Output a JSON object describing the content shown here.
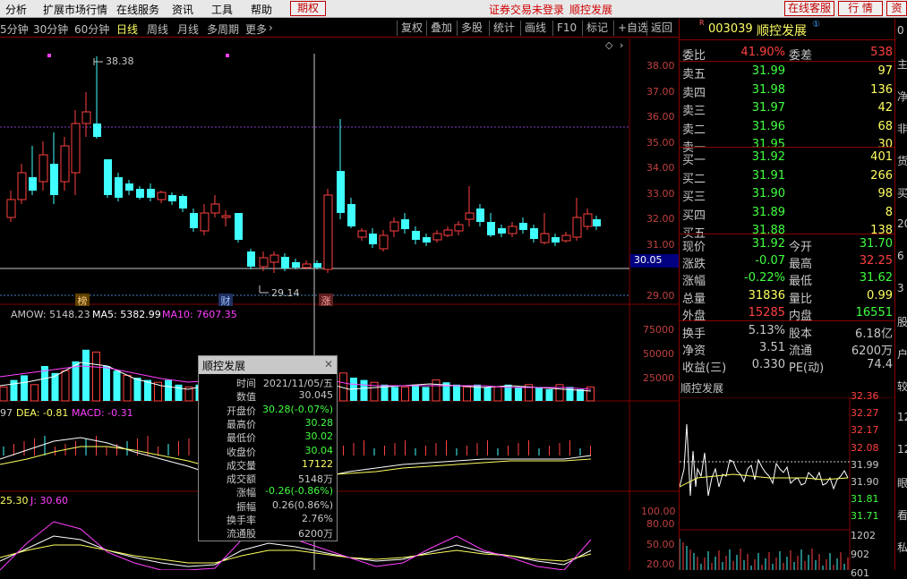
{
  "menu": {
    "items": [
      "分析",
      "扩展市场行情",
      "在线服务",
      "资讯",
      "工具",
      "帮助"
    ],
    "period_btn": "期权",
    "status_text": "证券交易未登录",
    "stock_name": "顺控发展",
    "right_buttons": [
      "在线客服",
      "行 情",
      "资"
    ]
  },
  "toolbar": {
    "periods": [
      "5分钟",
      "30分钟",
      "60分钟",
      "日线",
      "周线",
      "月线",
      "多周期",
      "更多"
    ],
    "active": "日线",
    "tools": [
      "复权",
      "叠加",
      "多股",
      "统计",
      "画线",
      "F10",
      "标记",
      "+自选",
      "返回"
    ]
  },
  "main_chart": {
    "price_axis": [
      "38.00",
      "37.00",
      "36.00",
      "35.00",
      "34.00",
      "33.00",
      "32.00",
      "31.00",
      "30.00",
      "29.00"
    ],
    "high_label": "38.38",
    "low_label": "29.14",
    "cursor_price": "30.05",
    "markers": [
      "榜",
      "财",
      "涨"
    ]
  },
  "volume_panel": {
    "labels": [
      {
        "text": "AMOW: 5148.23",
        "color": "#c8c8c8"
      },
      {
        "text": "MA5: 5382.99",
        "color": "#ffffff"
      },
      {
        "text": "MA10: 7607.35",
        "color": "#ff40ff"
      }
    ],
    "axis": [
      "75000",
      "50000",
      "25000"
    ]
  },
  "macd_panel": {
    "labels": [
      {
        "text": "97",
        "color": "#c8c8c8"
      },
      {
        "text": "DEA: -0.81",
        "color": "#ffff60"
      },
      {
        "text": "MACD: -0.31",
        "color": "#ff40ff"
      }
    ]
  },
  "kdj_panel": {
    "labels": [
      {
        "text": "25.30",
        "color": "#ffff60"
      },
      {
        "text": "J: 30.60",
        "color": "#ff40ff"
      }
    ],
    "axis": [
      "100.00",
      "80.00",
      "50.00",
      "20.00"
    ]
  },
  "popup": {
    "title": "顺控发展",
    "rows": [
      {
        "label": "时间",
        "value": "2021/11/05/五",
        "color": "#c8c8c8"
      },
      {
        "label": "数值",
        "value": "30.045",
        "color": "#c8c8c8"
      },
      {
        "label": "开盘价",
        "value": "30.28(-0.07%)",
        "color": "#40ff40"
      },
      {
        "label": "最高价",
        "value": "30.28",
        "color": "#40ff40"
      },
      {
        "label": "最低价",
        "value": "30.02",
        "color": "#40ff40"
      },
      {
        "label": "收盘价",
        "value": "30.04",
        "color": "#40ff40"
      },
      {
        "label": "成交量",
        "value": "17122",
        "color": "#ffff60"
      },
      {
        "label": "成交额",
        "value": "5148万",
        "color": "#c8c8c8"
      },
      {
        "label": "涨幅",
        "value": "-0.26(-0.86%)",
        "color": "#40ff40"
      },
      {
        "label": "振幅",
        "value": "0.26(0.86%)",
        "color": "#c8c8c8"
      },
      {
        "label": "换手率",
        "value": "2.76%",
        "color": "#c8c8c8"
      },
      {
        "label": "流通股",
        "value": "6200万",
        "color": "#c8c8c8"
      }
    ]
  },
  "quote": {
    "code": "003039",
    "name": "顺控发展",
    "weibi_label": "委比",
    "weibi": "41.90%",
    "weicha_label": "委差",
    "weicha": "538",
    "sells": [
      {
        "label": "卖五",
        "price": "31.99",
        "vol": "97"
      },
      {
        "label": "卖四",
        "price": "31.98",
        "vol": "136"
      },
      {
        "label": "卖三",
        "price": "31.97",
        "vol": "42"
      },
      {
        "label": "卖二",
        "price": "31.96",
        "vol": "68"
      },
      {
        "label": "卖一",
        "price": "31.95",
        "vol": "30"
      }
    ],
    "buys": [
      {
        "label": "买一",
        "price": "31.92",
        "vol": "401"
      },
      {
        "label": "买二",
        "price": "31.91",
        "vol": "266"
      },
      {
        "label": "买三",
        "price": "31.90",
        "vol": "98"
      },
      {
        "label": "买四",
        "price": "31.89",
        "vol": "8"
      },
      {
        "label": "买五",
        "price": "31.88",
        "vol": "138"
      }
    ],
    "stats": [
      {
        "l1": "现价",
        "v1": "31.92",
        "c1": "#40ff40",
        "l2": "今开",
        "v2": "31.70",
        "c2": "#40ff40"
      },
      {
        "l1": "涨跌",
        "v1": "-0.07",
        "c1": "#40ff40",
        "l2": "最高",
        "v2": "32.25",
        "c2": "#ff4040"
      },
      {
        "l1": "涨幅",
        "v1": "-0.22%",
        "c1": "#40ff40",
        "l2": "最低",
        "v2": "31.62",
        "c2": "#40ff40"
      },
      {
        "l1": "总量",
        "v1": "31836",
        "c1": "#ffff60",
        "l2": "量比",
        "v2": "0.99",
        "c2": "#ffff60"
      },
      {
        "l1": "外盘",
        "v1": "15285",
        "c1": "#ff4040",
        "l2": "内盘",
        "v2": "16551",
        "c2": "#40ff40"
      }
    ],
    "stats2": [
      {
        "l1": "换手",
        "v1": "5.13%",
        "l2": "股本",
        "v2": "6.18亿"
      },
      {
        "l1": "净资",
        "v1": "3.51",
        "l2": "流通",
        "v2": "6200万"
      },
      {
        "l1": "收益(三)",
        "v1": "0.330",
        "l2": "PE(动)",
        "v2": "74.4"
      }
    ],
    "mini_title": "顺控发展",
    "mini_axis": [
      "32.36",
      "32.27",
      "32.17",
      "32.08",
      "31.99",
      "31.90",
      "31.81",
      "31.71"
    ],
    "mini_vol_axis": [
      "1202",
      "902",
      "601"
    ]
  },
  "far_right": [
    "0",
    "主",
    "净",
    "非",
    "货",
    "买",
    "20",
    "6",
    "3",
    "股",
    "户",
    "较",
    "12",
    "12",
    "眼",
    "看",
    "私"
  ]
}
